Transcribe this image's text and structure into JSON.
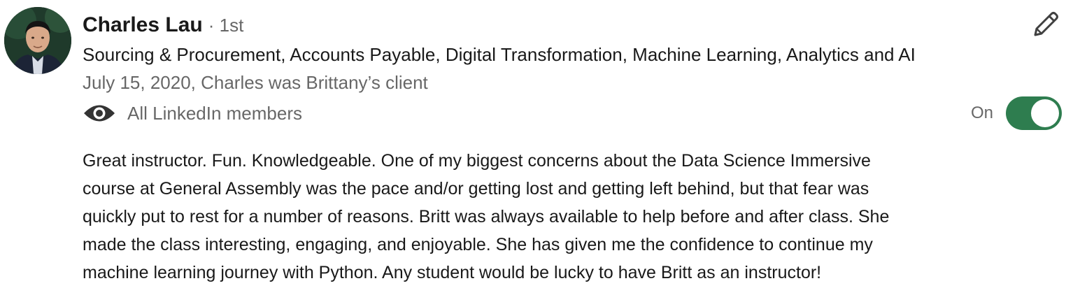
{
  "recommender": {
    "name": "Charles Lau",
    "degree": "· 1st",
    "headline": "Sourcing & Procurement, Accounts Payable, Digital Transformation, Machine Learning, Analytics and AI",
    "meta": "July 15, 2020, Charles was Brittany’s client"
  },
  "visibility": {
    "icon": "eye-icon",
    "label": "All LinkedIn members"
  },
  "actions": {
    "edit_icon": "pencil-icon"
  },
  "toggle": {
    "label": "On",
    "state": true,
    "color": "#2e7d4f"
  },
  "recommendation": {
    "text": "Great instructor. Fun. Knowledgeable. One of my biggest concerns about the Data Science Immersive\ncourse at General Assembly was the pace and/or getting lost and getting left behind, but that fear was\nquickly put to rest for a number of reasons. Britt was always available to help before and after class. She\nmade the class interesting, engaging, and enjoyable. She has given me the confidence to continue my\nmachine learning journey with Python. Any student would be lucky to have Britt as an instructor!"
  }
}
